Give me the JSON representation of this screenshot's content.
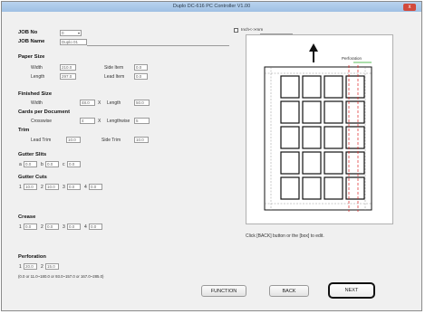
{
  "window": {
    "title": "Duplo DC-616 PC Controller V1.00",
    "close_label": "x"
  },
  "job": {
    "no_label": "JOB No",
    "no_value": "0",
    "name_label": "JOB Name",
    "name_value": "Duplo 01"
  },
  "paper_size": {
    "heading": "Paper Size",
    "width_label": "Width",
    "width_value": "210.0",
    "length_label": "Length",
    "length_value": "297.0",
    "side_label": "Side Item",
    "side_value": "0.0",
    "lead_label": "Lead Item",
    "lead_value": "0.0"
  },
  "finished_size": {
    "heading": "Finished Size",
    "width_label": "Width",
    "width_value": "48.0",
    "x": "X",
    "length_label": "Length",
    "length_value": "50.0"
  },
  "cards": {
    "heading": "Cards per Document",
    "crosswise_label": "Crosswise",
    "crosswise_value": "4",
    "x": "X",
    "lengthwise_label": "Lengthwise",
    "lengthwise_value": "5"
  },
  "trim": {
    "heading": "Trim",
    "lead_label": "Lead Trim",
    "lead_value": "10.0",
    "side_label": "Side Trim",
    "side_value": "10.0"
  },
  "gutter_slits": {
    "heading": "Gutter Slits",
    "values": [
      "0.0",
      "0.0",
      "0.0"
    ],
    "labels": [
      "a",
      "b",
      "c"
    ]
  },
  "gutter_cuts": {
    "heading": "Gutter Cuts",
    "values": [
      "10.0",
      "10.0",
      "0.0",
      "0.0"
    ],
    "labels": [
      "1",
      "2",
      "3",
      "4"
    ]
  },
  "crease": {
    "heading": "Crease",
    "values": [
      "0.0",
      "0.0",
      "0.0",
      "0.0"
    ],
    "labels": [
      "1",
      "2",
      "3",
      "4"
    ]
  },
  "perforation": {
    "heading": "Perforation",
    "values": [
      "20.0",
      "15.0"
    ],
    "labels": [
      "1",
      "2"
    ],
    "range_note": "(0.0 or 11.0~180.0 or 93.0~157.0 or 167.0~285.0)"
  },
  "preview": {
    "checkbox_label": "Inch<->mm",
    "perforation_label": "Perforation",
    "hint": "Click [BACK] button or the [box] to edit."
  },
  "buttons": {
    "function": "FUNCTION",
    "back": "BACK",
    "next": "NEXT"
  }
}
